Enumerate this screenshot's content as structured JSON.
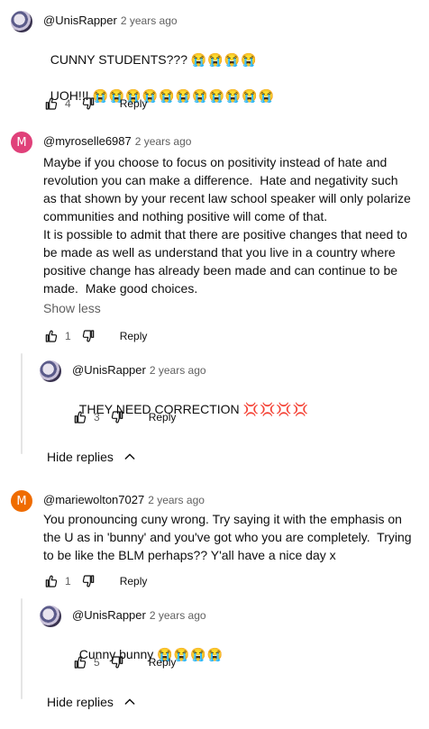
{
  "comments": [
    {
      "author": "@UnisRapper",
      "time": "2 years ago",
      "line1": "CUNNY STUDENTS???",
      "line1_emoji": "😭😭😭😭",
      "line2": "UOH!!!",
      "line2_emoji": "😭😭😭😭😭😭😭😭😭😭😭",
      "likes": "4",
      "reply_label": "Reply"
    },
    {
      "author": "@myroselle6987",
      "avatar_letter": "M",
      "time": "2 years ago",
      "text": "Maybe if you choose to focus on positivity instead of hate and revolution you can make a difference.  Hate and negativity such as that shown by your recent law school speaker will only polarize communities and nothing positive will come of that.\nIt is possible to admit that there are positive changes that need to be made as well as understand that you live in a country where positive change has already been made and can continue to be made.  Make good choices.",
      "show_less": "Show less",
      "likes": "1",
      "reply_label": "Reply",
      "reply": {
        "author": "@UnisRapper",
        "time": "2 years ago",
        "text": "THEY NEED CORRECTION",
        "emoji": "💢💢💢💢",
        "likes": "3",
        "reply_label": "Reply"
      },
      "hide_replies": "Hide replies"
    },
    {
      "author": "@mariewolton7027",
      "avatar_letter": "M",
      "time": "2 years ago",
      "text": "You pronouncing cuny wrong. Try saying it with the emphasis on the U as in 'bunny' and you've got who you are completely.  Trying to be like the BLM perhaps?? Y'all have a nice day x",
      "likes": "1",
      "reply_label": "Reply",
      "reply": {
        "author": "@UnisRapper",
        "time": "2 years ago",
        "text": "Cunny bunny",
        "emoji": "😭😭😭😭",
        "likes": "5",
        "reply_label": "Reply"
      },
      "hide_replies": "Hide replies"
    }
  ]
}
